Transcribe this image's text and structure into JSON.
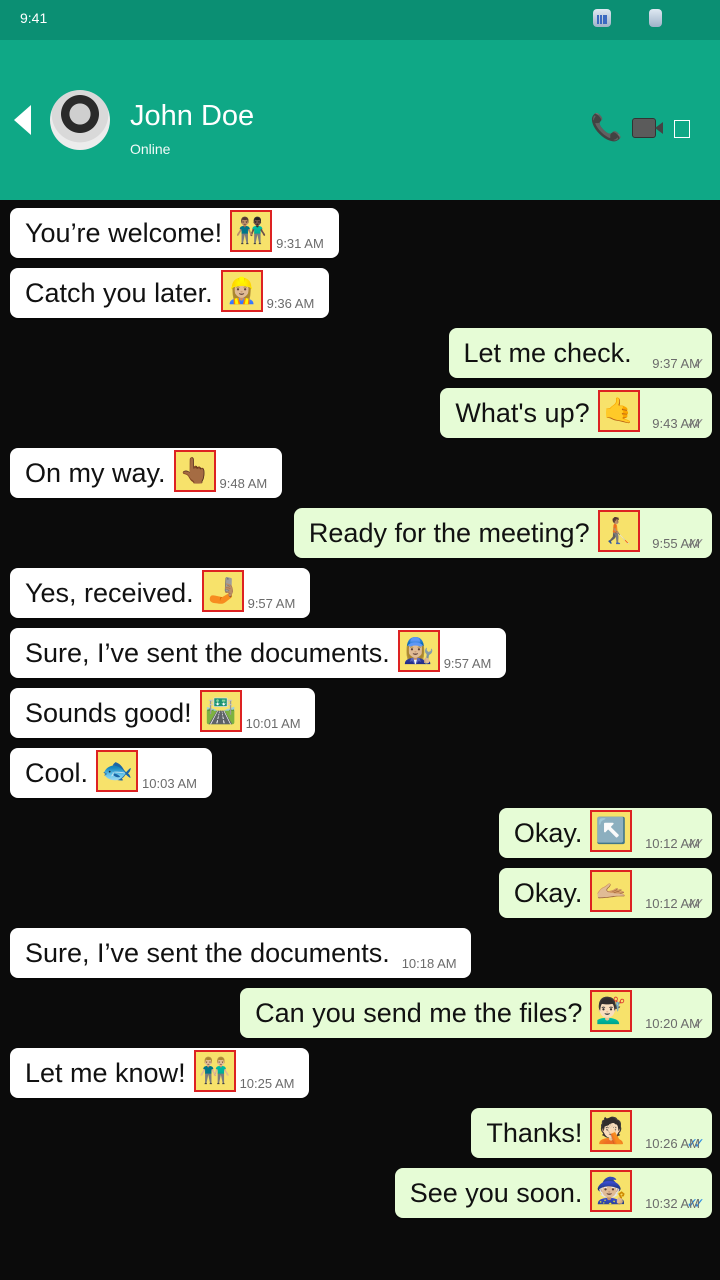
{
  "status_bar": {
    "time": "9:41",
    "signal_icon": "signal-icon",
    "battery_icon": "battery-icon"
  },
  "header": {
    "name": "John Doe",
    "status": "Online",
    "icons": [
      "back-icon",
      "avatar",
      "phone-icon",
      "video-call-icon",
      "menu-icon"
    ]
  },
  "messages": [
    {
      "dir": "in",
      "text": "You’re welcome!",
      "emoji": "👨🏽‍🤝‍👨🏿",
      "time": "9:31 AM"
    },
    {
      "dir": "in",
      "text": "Catch you later.",
      "emoji": "👷🏼‍♀️",
      "time": "9:36 AM"
    },
    {
      "dir": "out",
      "text": "Let me check.",
      "emoji": "",
      "time": "9:37 AM",
      "status": "sent"
    },
    {
      "dir": "out",
      "text": "What's up?",
      "emoji": "🤙",
      "time": "9:43 AM",
      "status": "delivered"
    },
    {
      "dir": "in",
      "text": "On my way.",
      "emoji": "👆🏾",
      "time": "9:48 AM"
    },
    {
      "dir": "out",
      "text": "Ready for the meeting?",
      "emoji": "🧑🏽‍🦯‍➡️",
      "time": "9:55 AM",
      "status": "delivered"
    },
    {
      "dir": "in",
      "text": "Yes, received.",
      "emoji": "🤳🏽",
      "time": "9:57 AM"
    },
    {
      "dir": "in",
      "text": "Sure, I’ve sent the documents.",
      "emoji": "👩🏼‍🔧",
      "time": "9:57 AM"
    },
    {
      "dir": "in",
      "text": "Sounds good!",
      "emoji": "🛣️",
      "time": "10:01 AM"
    },
    {
      "dir": "in",
      "text": "Cool.",
      "emoji": "🐟",
      "time": "10:03 AM"
    },
    {
      "dir": "out",
      "text": "Okay.",
      "emoji": "↖️",
      "time": "10:12 AM",
      "status": "delivered"
    },
    {
      "dir": "out",
      "text": "Okay.",
      "emoji": "🫴🏼",
      "time": "10:12 AM",
      "status": "delivered"
    },
    {
      "dir": "in",
      "text": "Sure, I’ve sent the documents.",
      "emoji": "",
      "time": "10:18 AM"
    },
    {
      "dir": "out",
      "text": "Can you send me the files?",
      "emoji": "💇🏻‍♂️",
      "time": "10:20 AM",
      "status": "sent"
    },
    {
      "dir": "in",
      "text": "Let me know!",
      "emoji": "👬🏼",
      "time": "10:25 AM"
    },
    {
      "dir": "out",
      "text": "Thanks!",
      "emoji": "🤦🏻",
      "time": "10:26 AM",
      "status": "read"
    },
    {
      "dir": "out",
      "text": "See you soon.",
      "emoji": "🧙🏼",
      "time": "10:32 AM",
      "status": "read"
    }
  ]
}
